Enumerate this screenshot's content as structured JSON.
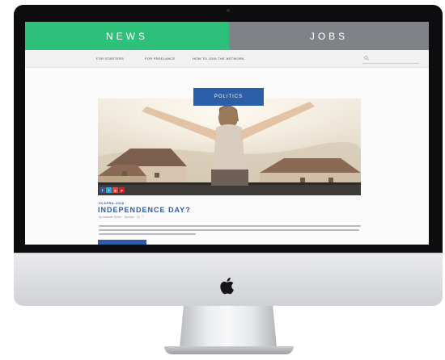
{
  "navigation": {
    "tabs": [
      {
        "label": "NEWS",
        "color": "#2cc07b"
      },
      {
        "label": "JOBS",
        "color": "#7f8287"
      }
    ]
  },
  "subnav": {
    "links": [
      "FOR STARTERS",
      "FOR FREELANCE",
      "HOW TO JOIN THE NETWORK"
    ]
  },
  "article": {
    "category": "POLITICS",
    "date": "20 APRIL 2018",
    "title": "INDEPENDENCE DAY?",
    "meta": "by Julianne Green · Opinion · 12 · 7"
  },
  "colors": {
    "accent_blue": "#2d5fa8",
    "accent_green": "#2cc07b"
  },
  "icons": [
    "search-icon",
    "apple-logo-icon",
    "facebook-icon",
    "twitter-icon",
    "google-plus-icon",
    "pinterest-icon"
  ]
}
